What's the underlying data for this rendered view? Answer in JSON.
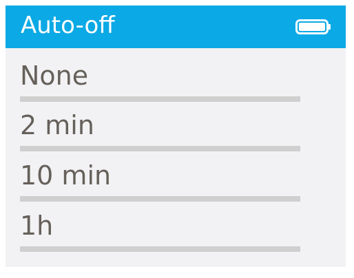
{
  "header": {
    "title": "Auto-off",
    "battery_icon": "battery-icon",
    "accent_color": "#0ba9e5"
  },
  "menu": {
    "items": [
      {
        "label": "None"
      },
      {
        "label": "2 min"
      },
      {
        "label": "10 min"
      },
      {
        "label": "1h"
      }
    ]
  }
}
